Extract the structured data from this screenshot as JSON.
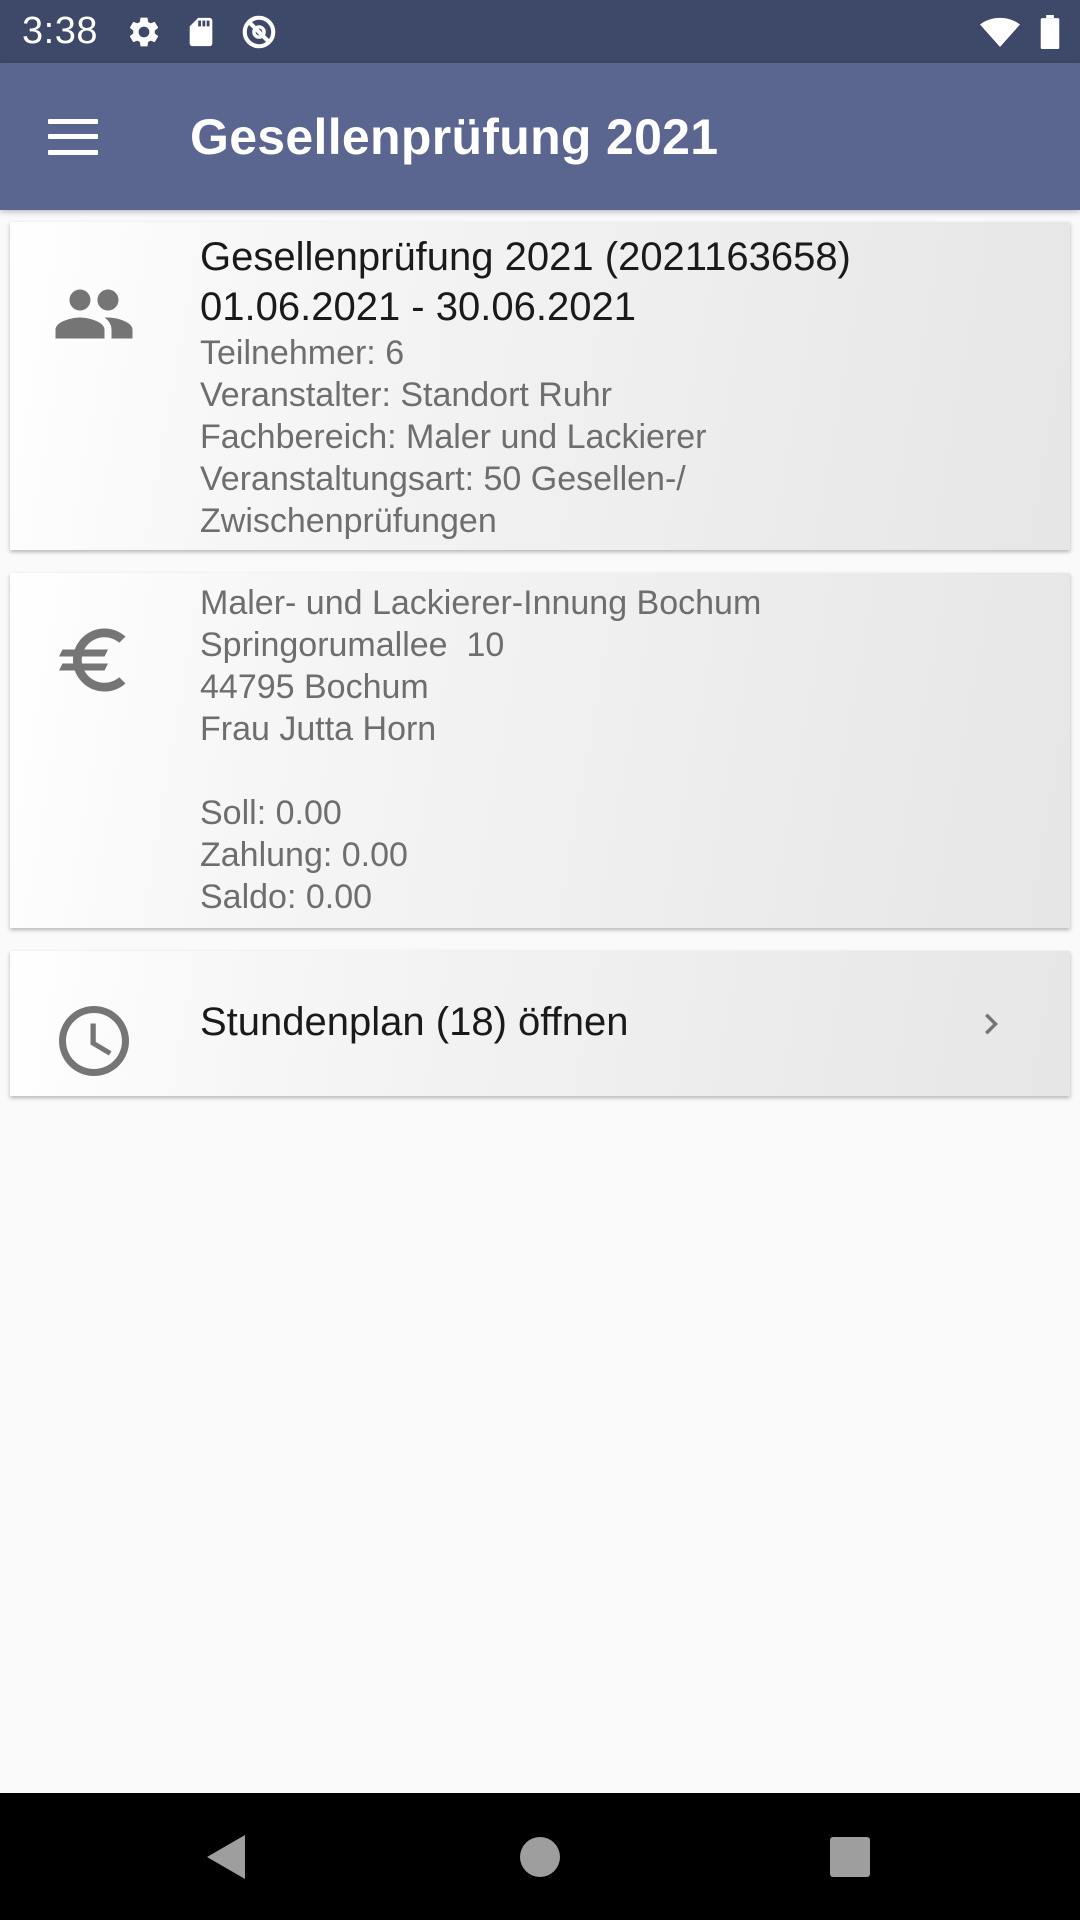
{
  "status_bar": {
    "time": "3:38",
    "icons": [
      "gear-icon",
      "sd-card-icon",
      "sync-off-icon",
      "wifi-icon",
      "battery-icon"
    ]
  },
  "app_bar": {
    "title": "Gesellenprüfung 2021",
    "menu_icon": "menu-icon"
  },
  "event_card": {
    "icon": "people-icon",
    "title": "Gesellenprüfung 2021 (2021163658)",
    "date_range": "01.06.2021 - 30.06.2021",
    "participants": "Teilnehmer: 6",
    "organizer": "Veranstalter: Standort Ruhr",
    "department": "Fachbereich: Maler und Lackierer",
    "event_type_line1": "Veranstaltungsart: 50 Gesellen-/",
    "event_type_line2": "Zwischenprüfungen"
  },
  "billing_card": {
    "icon": "euro-icon",
    "address_name": "Maler- und Lackierer-Innung Bochum",
    "address_street": "Springorumallee  10",
    "address_city": "44795 Bochum",
    "contact": "Frau Jutta Horn",
    "soll": "Soll: 0.00",
    "zahlung": "Zahlung: 0.00",
    "saldo": "Saldo: 0.00"
  },
  "schedule_card": {
    "icon": "clock-icon",
    "label": "Stundenplan (18) öffnen",
    "chevron_icon": "chevron-right-icon"
  },
  "nav_bar": {
    "buttons": [
      "back-button",
      "home-button",
      "recents-button"
    ]
  },
  "colors": {
    "status_bar": "#3e4868",
    "app_bar": "#5a6690",
    "background": "#fafafa",
    "icon_gray": "#757575"
  }
}
